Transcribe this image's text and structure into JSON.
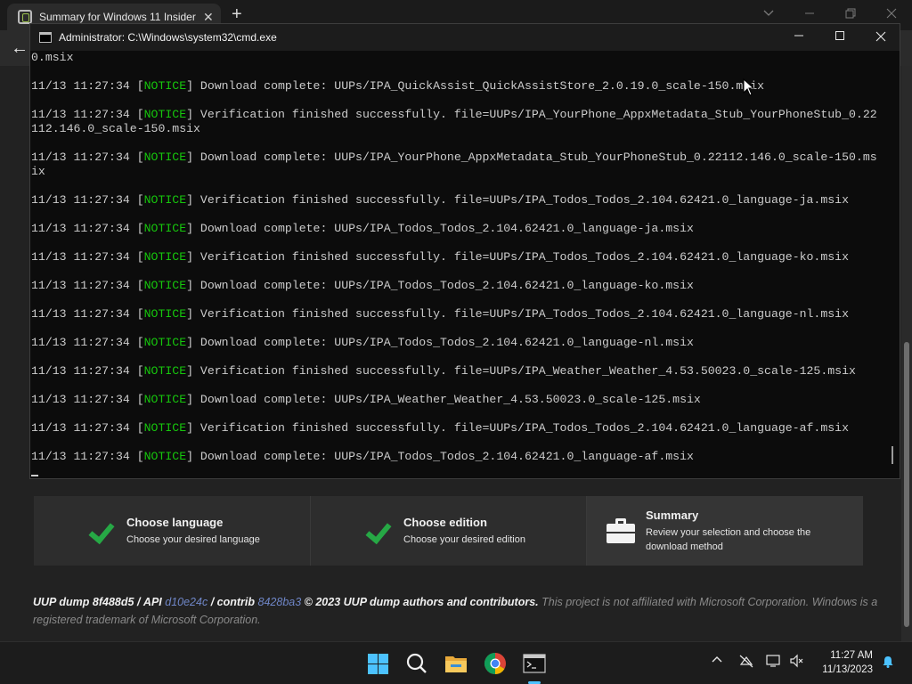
{
  "browser": {
    "tab_title": "Summary for Windows 11 Insider",
    "tab_close": "✕",
    "new_tab": "+",
    "back": "←"
  },
  "steps": {
    "language": {
      "title": "Choose language",
      "desc": "Choose your desired language"
    },
    "edition": {
      "title": "Choose edition",
      "desc": "Choose your desired edition"
    },
    "summary": {
      "title": "Summary",
      "desc": "Review your selection and choose the download method"
    }
  },
  "footer": {
    "project": "UUP dump",
    "project_ver": "8f488d5",
    "sep1": "/",
    "api": "API",
    "api_ver": "d10e24c",
    "sep2": "/",
    "contrib": "contrib",
    "contrib_ver": "8428ba3",
    "copyright": "© 2023 UUP dump authors and contributors.",
    "disclaimer": "This project is not affiliated with Microsoft Corporation. Windows is a registered trademark of Microsoft Corporation."
  },
  "cmd": {
    "title": "Administrator: C:\\Windows\\system32\\cmd.exe",
    "lines": [
      {
        "pre": "0.msix",
        "tag": "",
        "post": ""
      },
      {
        "pre": "",
        "tag": "",
        "post": ""
      },
      {
        "pre": "11/13 11:27:34 [",
        "tag": "NOTICE",
        "post": "] Download complete: UUPs/IPA_QuickAssist_QuickAssistStore_2.0.19.0_scale-150.msix"
      },
      {
        "pre": "",
        "tag": "",
        "post": ""
      },
      {
        "pre": "11/13 11:27:34 [",
        "tag": "NOTICE",
        "post": "] Verification finished successfully. file=UUPs/IPA_YourPhone_AppxMetadata_Stub_YourPhoneStub_0.22"
      },
      {
        "pre": "112.146.0_scale-150.msix",
        "tag": "",
        "post": ""
      },
      {
        "pre": "",
        "tag": "",
        "post": ""
      },
      {
        "pre": "11/13 11:27:34 [",
        "tag": "NOTICE",
        "post": "] Download complete: UUPs/IPA_YourPhone_AppxMetadata_Stub_YourPhoneStub_0.22112.146.0_scale-150.ms"
      },
      {
        "pre": "ix",
        "tag": "",
        "post": ""
      },
      {
        "pre": "",
        "tag": "",
        "post": ""
      },
      {
        "pre": "11/13 11:27:34 [",
        "tag": "NOTICE",
        "post": "] Verification finished successfully. file=UUPs/IPA_Todos_Todos_2.104.62421.0_language-ja.msix"
      },
      {
        "pre": "",
        "tag": "",
        "post": ""
      },
      {
        "pre": "11/13 11:27:34 [",
        "tag": "NOTICE",
        "post": "] Download complete: UUPs/IPA_Todos_Todos_2.104.62421.0_language-ja.msix"
      },
      {
        "pre": "",
        "tag": "",
        "post": ""
      },
      {
        "pre": "11/13 11:27:34 [",
        "tag": "NOTICE",
        "post": "] Verification finished successfully. file=UUPs/IPA_Todos_Todos_2.104.62421.0_language-ko.msix"
      },
      {
        "pre": "",
        "tag": "",
        "post": ""
      },
      {
        "pre": "11/13 11:27:34 [",
        "tag": "NOTICE",
        "post": "] Download complete: UUPs/IPA_Todos_Todos_2.104.62421.0_language-ko.msix"
      },
      {
        "pre": "",
        "tag": "",
        "post": ""
      },
      {
        "pre": "11/13 11:27:34 [",
        "tag": "NOTICE",
        "post": "] Verification finished successfully. file=UUPs/IPA_Todos_Todos_2.104.62421.0_language-nl.msix"
      },
      {
        "pre": "",
        "tag": "",
        "post": ""
      },
      {
        "pre": "11/13 11:27:34 [",
        "tag": "NOTICE",
        "post": "] Download complete: UUPs/IPA_Todos_Todos_2.104.62421.0_language-nl.msix"
      },
      {
        "pre": "",
        "tag": "",
        "post": ""
      },
      {
        "pre": "11/13 11:27:34 [",
        "tag": "NOTICE",
        "post": "] Verification finished successfully. file=UUPs/IPA_Weather_Weather_4.53.50023.0_scale-125.msix"
      },
      {
        "pre": "",
        "tag": "",
        "post": ""
      },
      {
        "pre": "11/13 11:27:34 [",
        "tag": "NOTICE",
        "post": "] Download complete: UUPs/IPA_Weather_Weather_4.53.50023.0_scale-125.msix"
      },
      {
        "pre": "",
        "tag": "",
        "post": ""
      },
      {
        "pre": "11/13 11:27:34 [",
        "tag": "NOTICE",
        "post": "] Verification finished successfully. file=UUPs/IPA_Todos_Todos_2.104.62421.0_language-af.msix"
      },
      {
        "pre": "",
        "tag": "",
        "post": ""
      },
      {
        "pre": "11/13 11:27:34 [",
        "tag": "NOTICE",
        "post": "] Download complete: UUPs/IPA_Todos_Todos_2.104.62421.0_language-af.msix"
      }
    ]
  },
  "taskbar": {
    "time": "11:27 AM",
    "date": "11/13/2023"
  },
  "colors": {
    "notice": "#16c60c",
    "check": "#26a845",
    "link": "#6f86c7",
    "accent": "#4cc2ff"
  }
}
